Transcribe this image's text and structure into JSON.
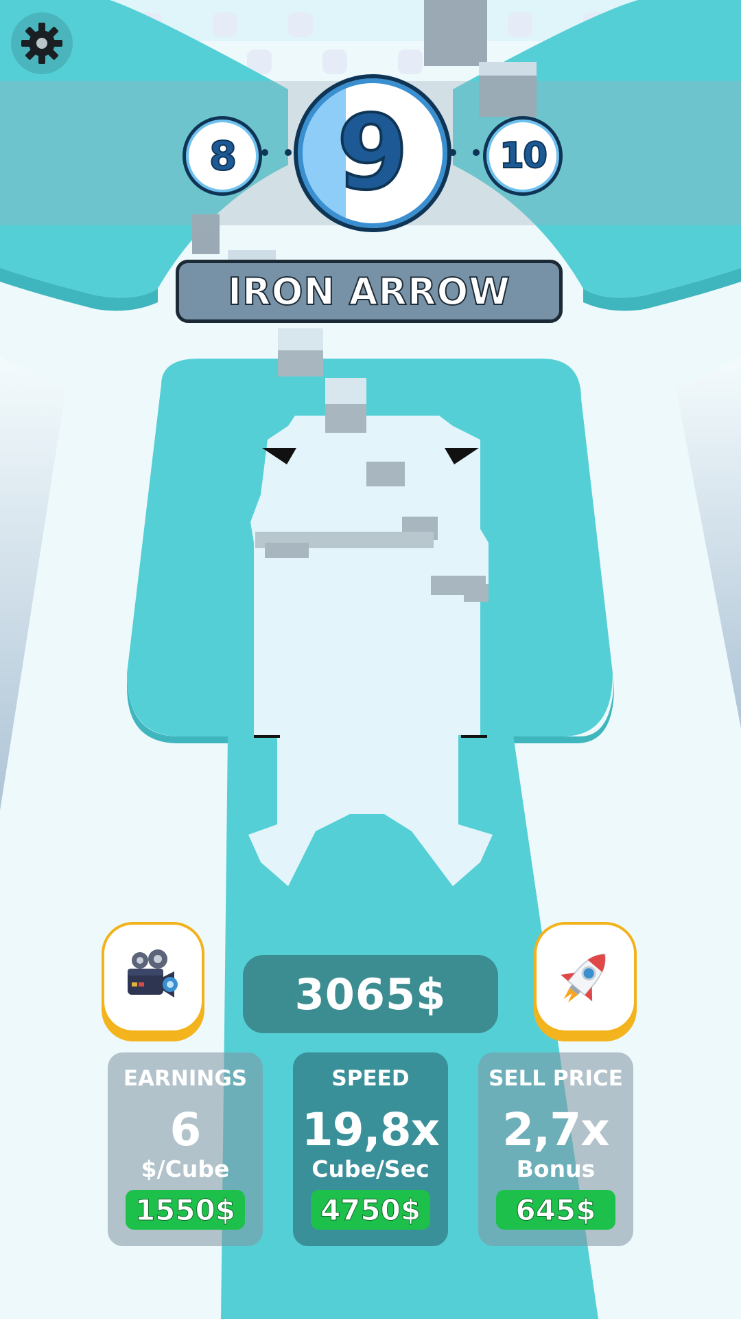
{
  "colors": {
    "accent_teal": "#55cfd6",
    "money_bg": "#3b8d92",
    "buy_green": "#1dc04a",
    "banner_bg": "#7792a6",
    "side_button_border": "#f2b21a"
  },
  "hud": {
    "settings_icon": "gear-icon",
    "level": {
      "previous": "8",
      "current": "9",
      "next": "10"
    },
    "title": "IRON ARROW"
  },
  "money": {
    "amount": "3065$"
  },
  "buttons": {
    "left_icon": "video-camera-icon",
    "right_icon": "rocket-icon"
  },
  "stats": {
    "earnings": {
      "title": "EARNINGS",
      "value": "6",
      "unit": "$/Cube",
      "price": "1550$"
    },
    "speed": {
      "title": "SPEED",
      "value": "19,8x",
      "unit": "Cube/Sec",
      "price": "4750$"
    },
    "sell_price": {
      "title": "SELL PRICE",
      "value": "2,7x",
      "unit": "Bonus",
      "price": "645$"
    }
  }
}
